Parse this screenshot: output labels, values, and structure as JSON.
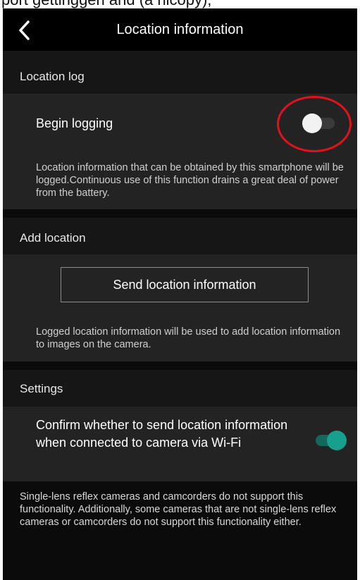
{
  "top_strip_text": "port gettinggen and (a nicopy),",
  "appbar": {
    "back_icon": "chevron-left-icon",
    "title": "Location information"
  },
  "location_log": {
    "header": "Location log",
    "begin_logging": {
      "label": "Begin logging",
      "toggle_on": false
    },
    "description": "Location information that can be obtained by this smartphone will be logged.Continuous use of this function drains a great deal of power from the battery."
  },
  "add_location": {
    "header": "Add location",
    "send_button_label": "Send location information",
    "description": "Logged location information will be used to add location information to images on the camera."
  },
  "settings": {
    "header": "Settings",
    "confirm_send": {
      "label": "Confirm whether to send location information when connected to camera via Wi-Fi",
      "toggle_on": true
    }
  },
  "footer_note": "Single-lens reflex cameras and camcorders do not support this functionality. Additionally, some cameras that are not single-lens reflex cameras or camcorders do not support this functionality either.",
  "colors": {
    "background": "#0b0b0b",
    "panel": "#232323",
    "section_header": "#161616",
    "toggle_on_thumb": "#16a08d",
    "annotation": "#e1121c"
  }
}
